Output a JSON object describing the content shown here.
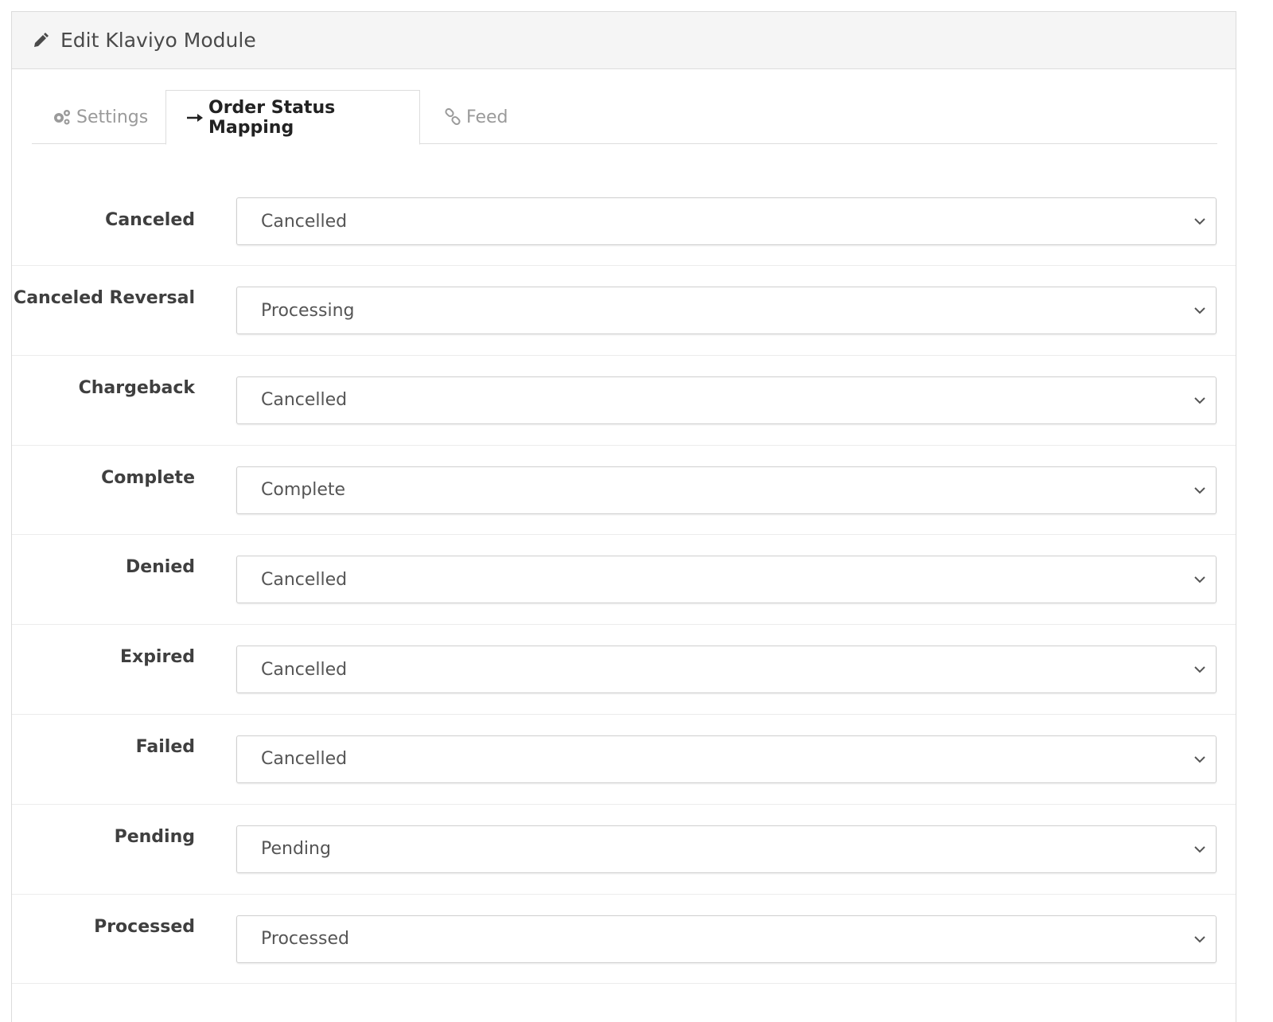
{
  "panel": {
    "title": "Edit Klaviyo Module",
    "icon": "pencil-icon"
  },
  "tabs": [
    {
      "label": "Settings",
      "icon": "gears-icon",
      "active": false
    },
    {
      "label": "Order Status Mapping",
      "icon": "arrow-right-icon",
      "active": true
    },
    {
      "label": "Feed",
      "icon": "link-icon",
      "active": false
    }
  ],
  "mapping": [
    {
      "label": "Canceled",
      "value": "Cancelled"
    },
    {
      "label": "Canceled Reversal",
      "value": "Processing"
    },
    {
      "label": "Chargeback",
      "value": "Cancelled"
    },
    {
      "label": "Complete",
      "value": "Complete"
    },
    {
      "label": "Denied",
      "value": "Cancelled"
    },
    {
      "label": "Expired",
      "value": "Cancelled"
    },
    {
      "label": "Failed",
      "value": "Cancelled"
    },
    {
      "label": "Pending",
      "value": "Pending"
    },
    {
      "label": "Processed",
      "value": "Processed"
    }
  ],
  "colors": {
    "heading_bg": "#f5f5f5",
    "border": "#dcdcdc",
    "active_tab_text": "#222222",
    "inactive_tab_text": "#9a9a9a"
  }
}
